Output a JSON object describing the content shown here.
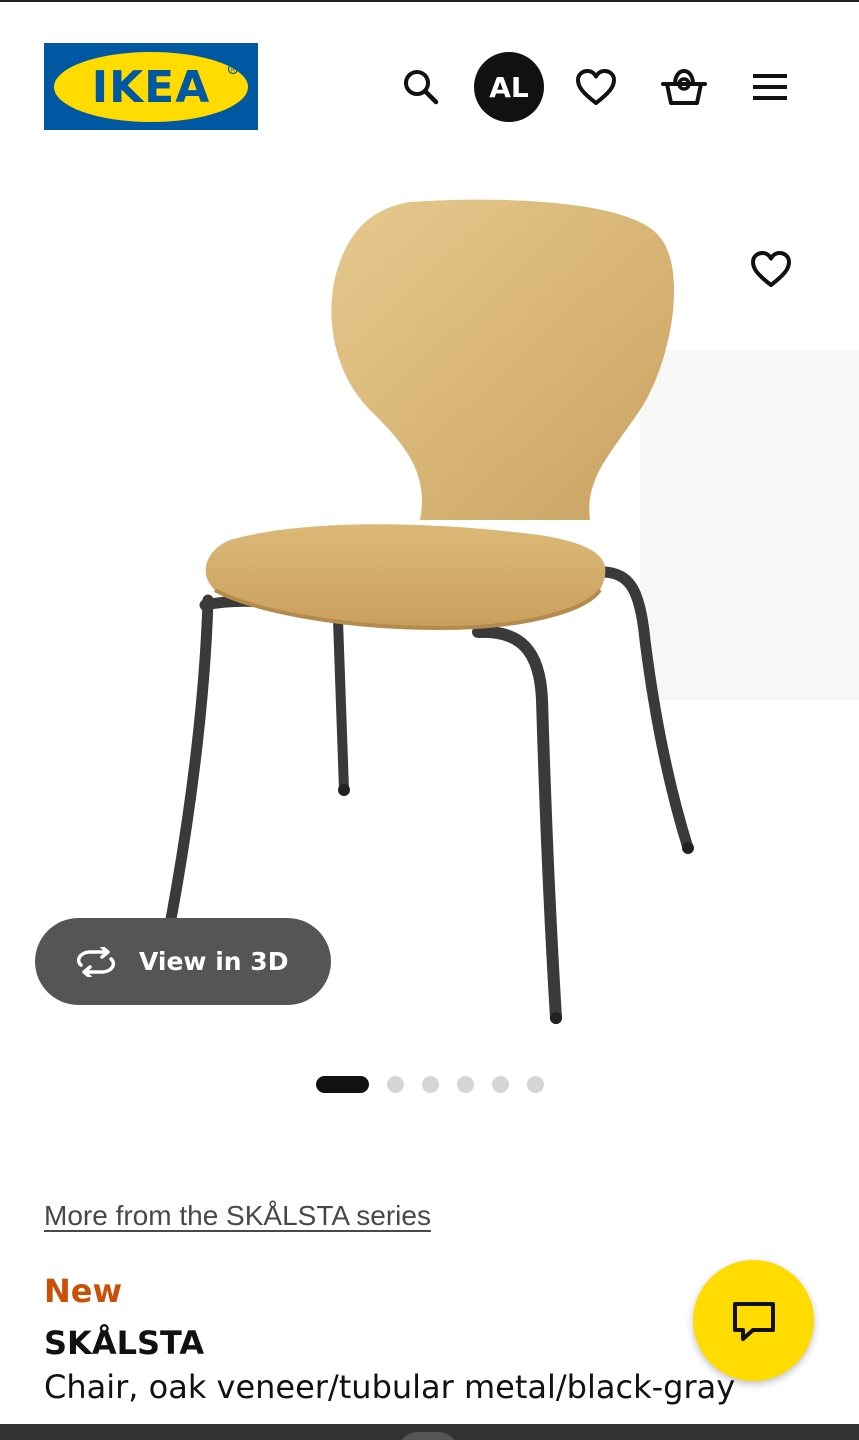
{
  "header": {
    "logo_text": "IKEA",
    "account_initials": "AL",
    "icons": [
      "search-icon",
      "heart-icon",
      "shopping-bag-icon",
      "menu-icon"
    ]
  },
  "product_image": {
    "favorite_icon": "heart-icon",
    "view3d_label": "View in 3D",
    "view3d_icon": "rotate-3d-icon",
    "carousel": {
      "total": 6,
      "active_index": 0
    }
  },
  "product": {
    "series_link": "More from the SKÅLSTA series",
    "badge": "New",
    "name": "SKÅLSTA",
    "description": "Chair, oak veneer/tubular metal/black-gray"
  },
  "chat": {
    "icon": "chat-icon"
  },
  "colors": {
    "ikea_blue": "#0058a3",
    "ikea_yellow": "#ffdb00",
    "new_badge": "#ca5008",
    "view3d_bg": "#555555"
  }
}
